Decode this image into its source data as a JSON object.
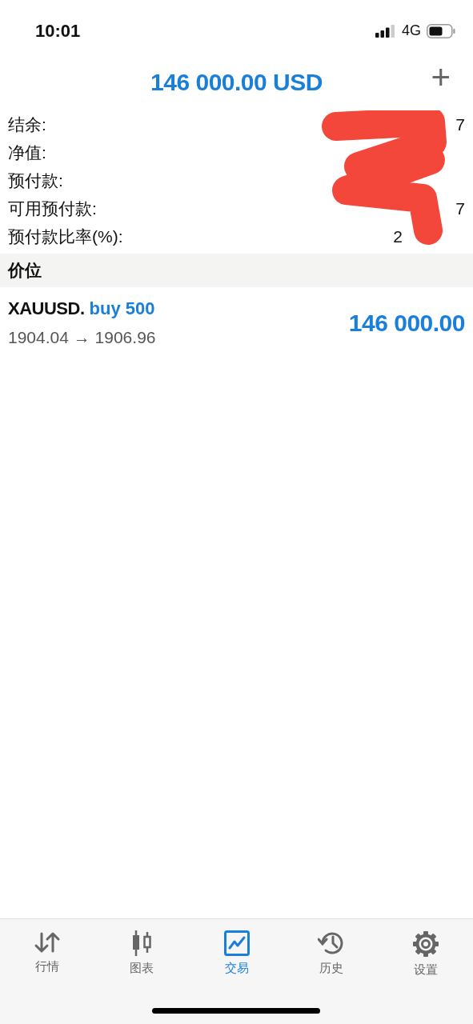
{
  "status_bar": {
    "time": "10:01",
    "network": "4G"
  },
  "header": {
    "title": "146 000.00 USD",
    "add_button": "+"
  },
  "account_rows": [
    {
      "label": "结余:",
      "values": [
        "7"
      ]
    },
    {
      "label": "净值:",
      "values": []
    },
    {
      "label": "预付款:",
      "values": []
    },
    {
      "label": "可用预付款:",
      "values": [
        "7"
      ]
    },
    {
      "label": "预付款比率(%):",
      "values": [
        "2"
      ]
    }
  ],
  "redaction": {
    "kind": "scribble",
    "color": "#f3473c"
  },
  "section_title": "价位",
  "positions": [
    {
      "symbol": "XAUUSD.",
      "order": "buy 500",
      "prices": "1904.04 → 1906.96",
      "profit": "146 000.00"
    }
  ],
  "tabs": [
    {
      "label": "行情",
      "selected": false
    },
    {
      "label": "图表",
      "selected": false
    },
    {
      "label": "交易",
      "selected": true
    },
    {
      "label": "历史",
      "selected": false
    },
    {
      "label": "设置",
      "selected": false
    }
  ]
}
